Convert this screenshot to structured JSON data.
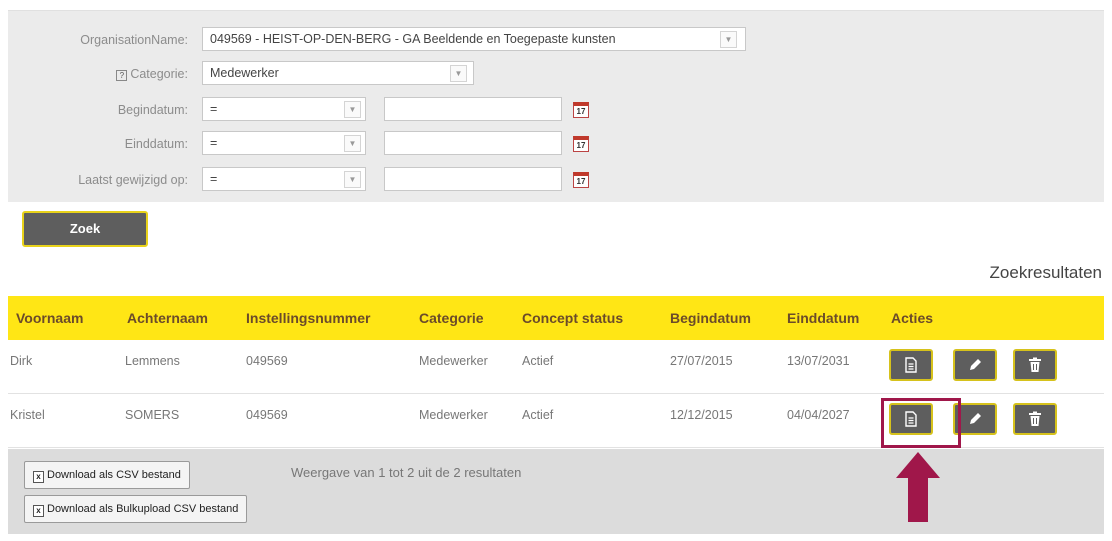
{
  "filters": {
    "organisation": {
      "label": "OrganisationName:",
      "value": "049569 - HEIST-OP-DEN-BERG - GA Beeldende en Toegepaste kunsten"
    },
    "categorie": {
      "help": "?",
      "label": "Categorie:",
      "value": "Medewerker"
    },
    "begindatum": {
      "label": "Begindatum:",
      "operator": "=",
      "value": ""
    },
    "einddatum": {
      "label": "Einddatum:",
      "operator": "=",
      "value": ""
    },
    "laatst_gewijzigd": {
      "label": "Laatst gewijzigd op:",
      "operator": "=",
      "value": ""
    },
    "calendar_icon_text": "17"
  },
  "search_button": "Zoek",
  "results_title": "Zoekresultaten",
  "table": {
    "headers": [
      "Voornaam",
      "Achternaam",
      "Instellingsnummer",
      "Categorie",
      "Concept status",
      "Begindatum",
      "Einddatum",
      "Acties"
    ],
    "rows": [
      {
        "voornaam": "Dirk",
        "achternaam": "Lemmens",
        "instellingsnummer": "049569",
        "categorie": "Medewerker",
        "status": "Actief",
        "begindatum": "27/07/2015",
        "einddatum": "13/07/2031"
      },
      {
        "voornaam": "Kristel",
        "achternaam": "SOMERS",
        "instellingsnummer": "049569",
        "categorie": "Medewerker",
        "status": "Actief",
        "begindatum": "12/12/2015",
        "einddatum": "04/04/2027"
      }
    ],
    "actions": [
      "document-icon",
      "pencil-icon",
      "trash-icon"
    ]
  },
  "footer": {
    "download_csv": "Download als CSV bestand",
    "download_bulk": "Download als Bulkupload CSV bestand",
    "summary": "Weergave van 1 tot 2 uit de 2 resultaten"
  },
  "colors": {
    "header_yellow": "#ffe615",
    "button_grey": "#5e5e5e",
    "highlight": "#a0174a"
  }
}
